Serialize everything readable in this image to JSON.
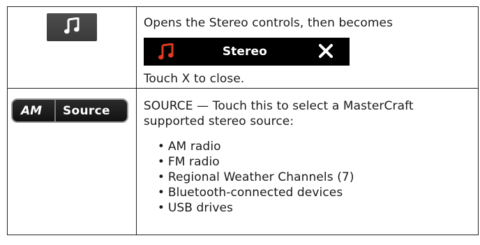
{
  "row_stereo": {
    "icon": "music-note-icon",
    "description_line1": "Opens the Stereo controls, then becomes",
    "bar_title": "Stereo",
    "bar_note_color": "#e23a1f",
    "bar_close_icon": "close-x-icon",
    "description_line2": "Touch X to close."
  },
  "row_source": {
    "button_left": "AM",
    "button_right": "Source",
    "description": "SOURCE — Touch this to select a MasterCraft supported stereo source:",
    "sources": [
      "AM radio",
      "FM radio",
      "Regional Weather Channels (7)",
      "Bluetooth-connected devices",
      "USB drives"
    ]
  }
}
